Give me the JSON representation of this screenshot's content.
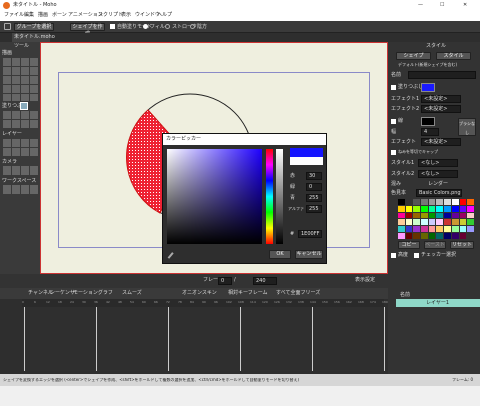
{
  "window": {
    "title": "未タイトル - Moho",
    "logo_color": "#e66a1e",
    "controls": [
      "—",
      "☐",
      "✕"
    ]
  },
  "menu": [
    "ファイル",
    "編集",
    "描画",
    "ボーン",
    "アニメーション",
    "スクリプト",
    "表示",
    "ウインドウ",
    "ヘルプ"
  ],
  "toolbar": {
    "mode_select": "グループを選択",
    "create_shape": "シェイプを作成",
    "auto_fill": "自動塗りモード",
    "fill": "フィル",
    "stroke": "ストローク",
    "stroke_short": "陰方"
  },
  "doc_tab": "未タイトル.moho",
  "tools": {
    "panel_title": "ツール",
    "sections": [
      "描画",
      "塗りつぶし",
      "レイヤー",
      "カメラ",
      "ワークスペース"
    ]
  },
  "style_panel": {
    "title": "スタイル",
    "shape_tab": "シェイプ",
    "style_tab": "スタイル",
    "defaults_label": "デフォルト(新規シェイプを含む)",
    "name_label": "名前",
    "fill_label": "塗りつぶし",
    "fill_color": "#1a1aff",
    "effect1_label": "エフェクト1",
    "effect1_value": "<未設定>",
    "effect2_label": "エフェクト2",
    "effect2_value": "<未設定>",
    "line_label": "線",
    "line_color": "#000000",
    "width_label": "幅",
    "width_value": "4",
    "effect_label": "エフェクト",
    "effect_value": "<未設定>",
    "brush_btn": "ブラシなし",
    "snap_label": "ねみを等切でキャップ",
    "style1_label": "スタイル1",
    "style1_value": "<なし>",
    "style2_label": "スタイル2",
    "style2_value": "<なし>",
    "blend_label": "混み",
    "blend_value": "レンダー",
    "swatch_label": "色見本",
    "swatch_value": "Basic Colors.png",
    "copy": "コピー",
    "paste": "ペースト",
    "reset": "リセット",
    "advanced": "高度",
    "checker": "チェッカー選択"
  },
  "layers": {
    "layer_name": "レイヤー1",
    "name_col": "名前"
  },
  "color_picker": {
    "title": "カラーピッカー",
    "selected_color": "#1414ff",
    "fields": [
      {
        "label": "赤",
        "value": "30"
      },
      {
        "label": "緑",
        "value": "0"
      },
      {
        "label": "青",
        "value": "255"
      },
      {
        "label": "アルファ",
        "value": "255"
      }
    ],
    "hex_label": "#",
    "hex_value": "1E00FF",
    "ok": "OK",
    "cancel": "キャンセル"
  },
  "timeline": {
    "tabs": [
      "チャンネル",
      "シーケンサ",
      "モーショングラフ"
    ],
    "smooth": "スムーズ",
    "frame_label": "フレーム",
    "frame_value": "0",
    "of_label": "/",
    "end_value": "240",
    "display_label": "表示設定",
    "onion": "オニオンスキン",
    "relative": "相対キーフレーム",
    "freeze": "すべて全面フリーズ",
    "ruler": [
      "0",
      "6",
      "12",
      "18",
      "24",
      "30",
      "36",
      "42",
      "48",
      "54",
      "60",
      "66",
      "72",
      "78",
      "84",
      "90",
      "96",
      "102",
      "108",
      "114",
      "120",
      "126",
      "132",
      "138",
      "144",
      "150",
      "156",
      "162",
      "168",
      "174",
      "180"
    ]
  },
  "status": {
    "text": "シェイプを変換するエッジを選択 (<enter>でシェイプを作成、<shift>をホールドして複数の選択を追加、<ctrl/cmd>をホールドして自動塗りモードを切り替え)",
    "frame": "フレーム: 0"
  },
  "palette": [
    "#000000",
    "#333333",
    "#555555",
    "#777777",
    "#999999",
    "#bbbbbb",
    "#dddddd",
    "#ffffff",
    "#ff0000",
    "#ff6600",
    "#ffcc00",
    "#ffff00",
    "#99ff00",
    "#00ff00",
    "#00ff99",
    "#00ffff",
    "#0099ff",
    "#0000ff",
    "#6600ff",
    "#ff00ff",
    "#ff0099",
    "#990000",
    "#996600",
    "#999900",
    "#009900",
    "#009999",
    "#000099",
    "#660099",
    "#990066",
    "#ffcccc",
    "#ffcc99",
    "#ffffcc",
    "#ccffcc",
    "#ccffff",
    "#ccccff",
    "#ffccff",
    "#cc3333",
    "#cc9933",
    "#cccc33",
    "#33cc33",
    "#33cccc",
    "#3333cc",
    "#9933cc",
    "#cc3399",
    "#ff9999",
    "#ffcc66",
    "#ffff99",
    "#99ff99",
    "#99ffff",
    "#9999ff",
    "#ff99ff",
    "#660000",
    "#663300",
    "#666600",
    "#006600",
    "#006666",
    "#000066",
    "#330066",
    "#660033"
  ]
}
